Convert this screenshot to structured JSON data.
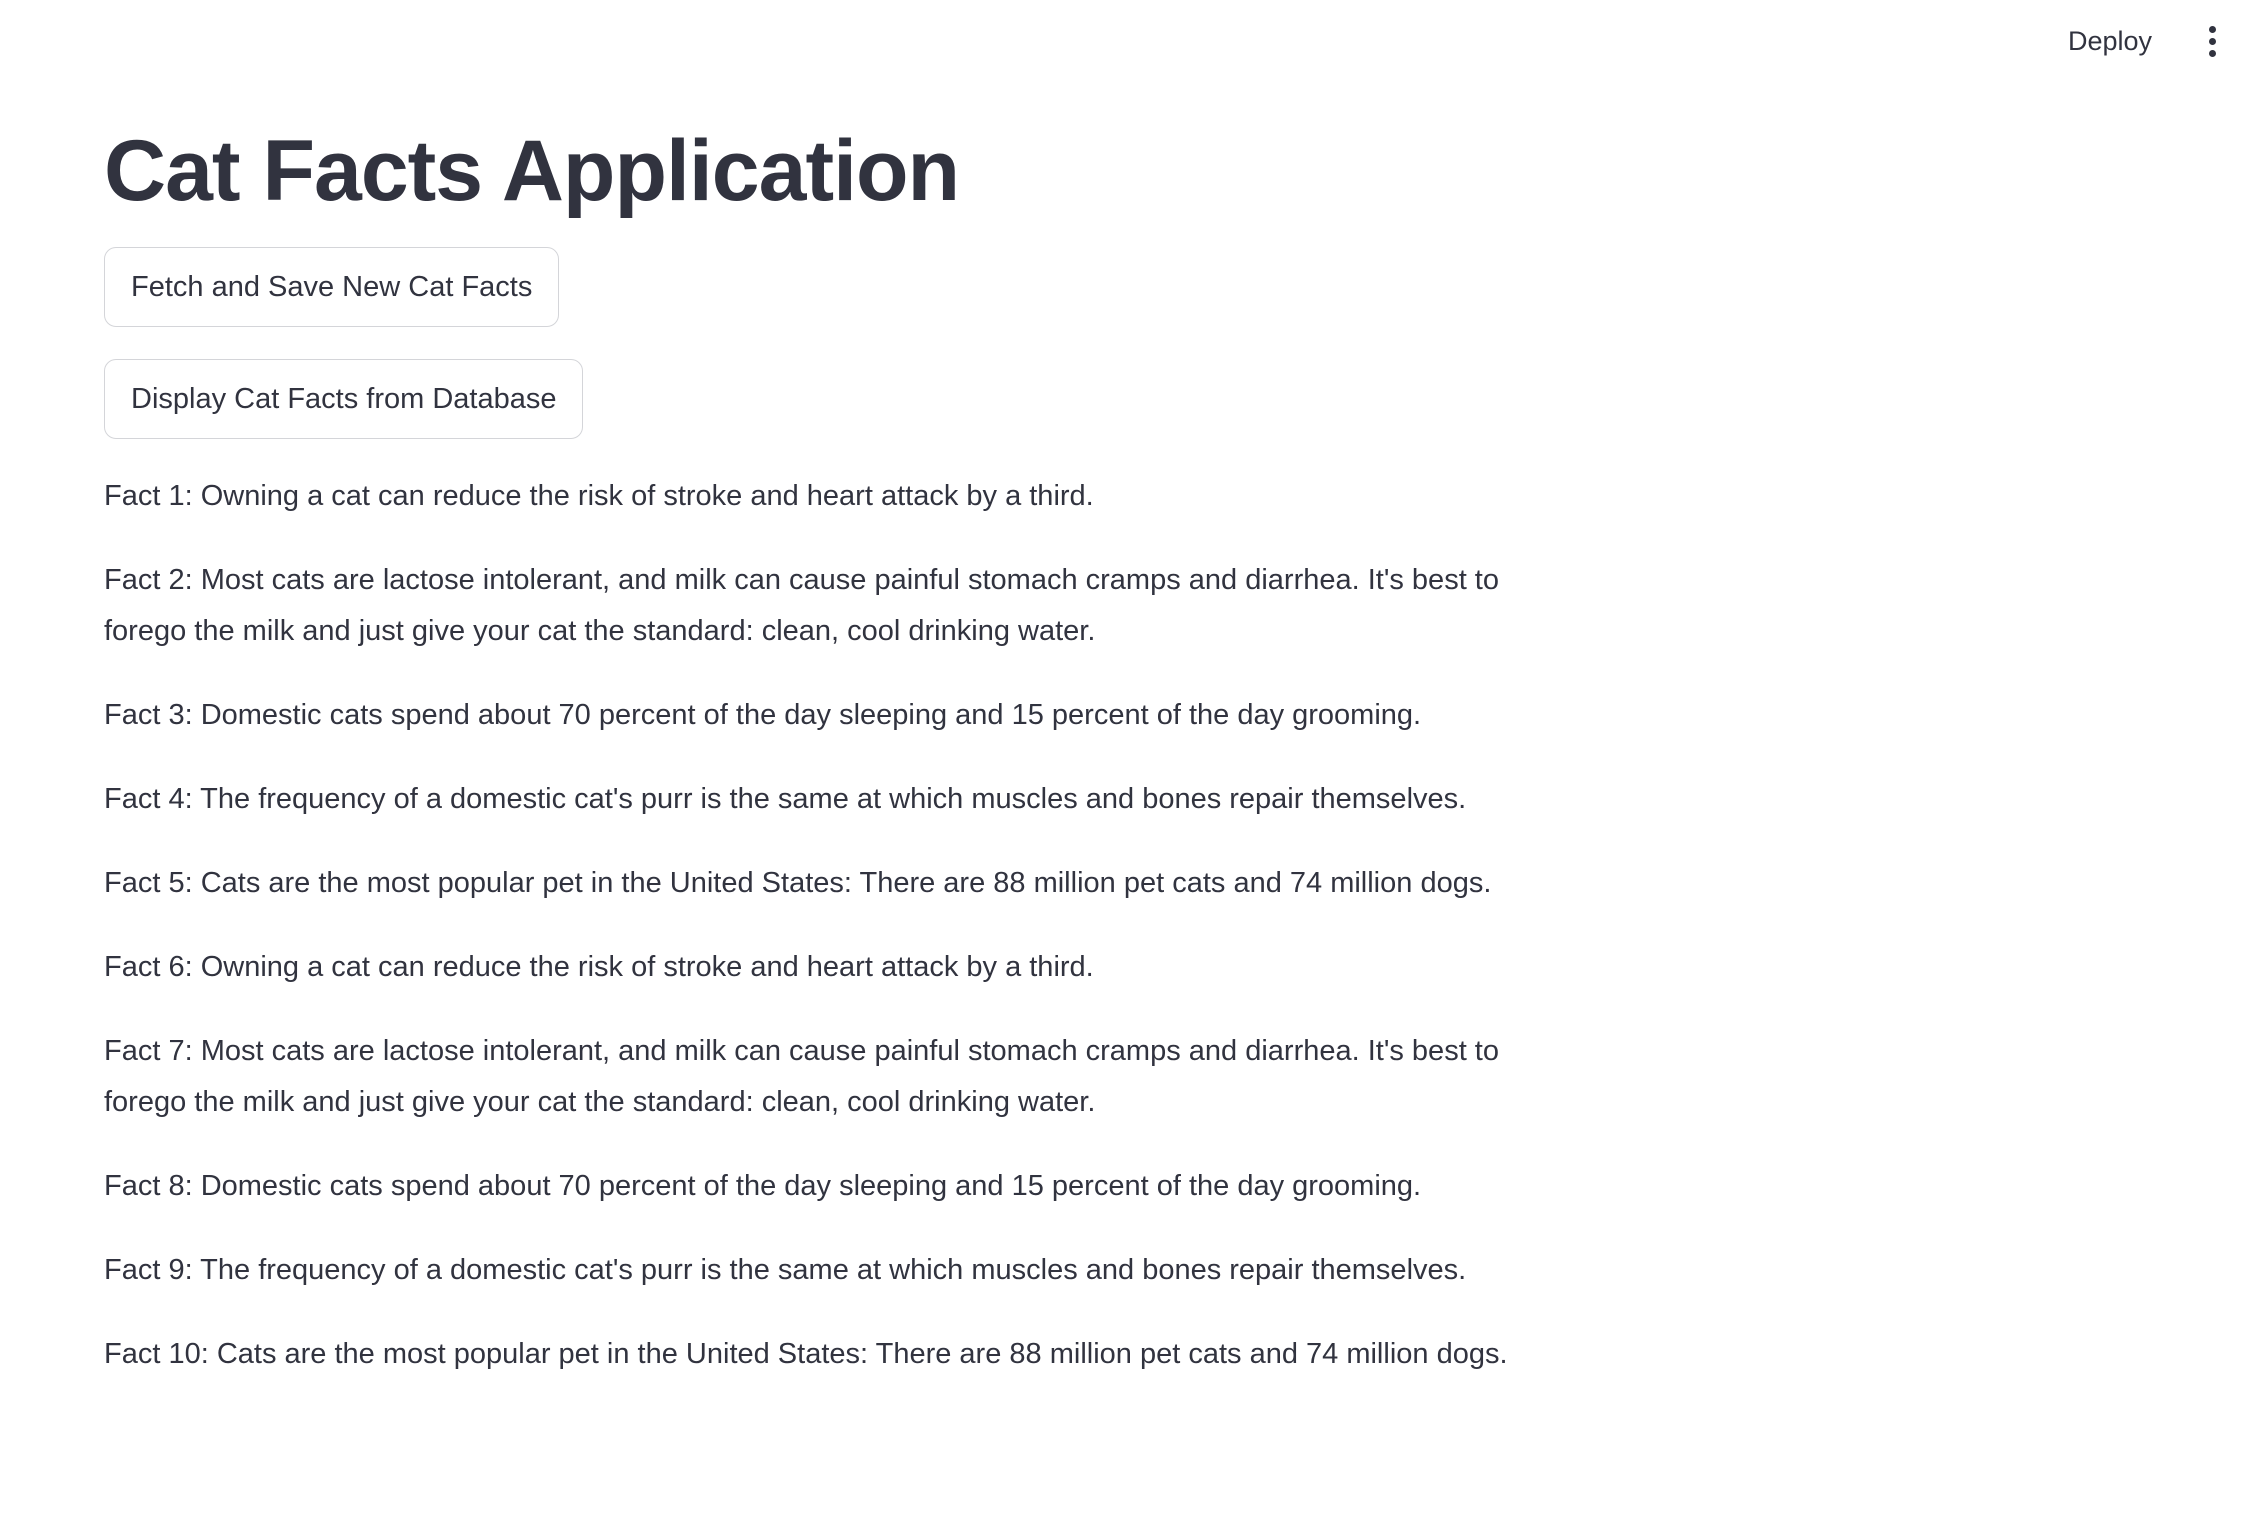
{
  "toolbar": {
    "deploy_label": "Deploy",
    "menu_icon": "vertical-ellipsis-icon"
  },
  "main": {
    "title": "Cat Facts Application",
    "buttons": {
      "fetch_label": "Fetch and Save New Cat Facts",
      "display_label": "Display Cat Facts from Database"
    },
    "facts": [
      "Fact 1: Owning a cat can reduce the risk of stroke and heart attack by a third.",
      "Fact 2: Most cats are lactose intolerant, and milk can cause painful stomach cramps and diarrhea. It's best to forego the milk and just give your cat the standard: clean, cool drinking water.",
      "Fact 3: Domestic cats spend about 70 percent of the day sleeping and 15 percent of the day grooming.",
      "Fact 4: The frequency of a domestic cat's purr is the same at which muscles and bones repair themselves.",
      "Fact 5: Cats are the most popular pet in the United States: There are 88 million pet cats and 74 million dogs.",
      "Fact 6: Owning a cat can reduce the risk of stroke and heart attack by a third.",
      "Fact 7: Most cats are lactose intolerant, and milk can cause painful stomach cramps and diarrhea. It's best to forego the milk and just give your cat the standard: clean, cool drinking water.",
      "Fact 8: Domestic cats spend about 70 percent of the day sleeping and 15 percent of the day grooming.",
      "Fact 9: The frequency of a domestic cat's purr is the same at which muscles and bones repair themselves.",
      "Fact 10: Cats are the most popular pet in the United States: There are 88 million pet cats and 74 million dogs."
    ]
  }
}
